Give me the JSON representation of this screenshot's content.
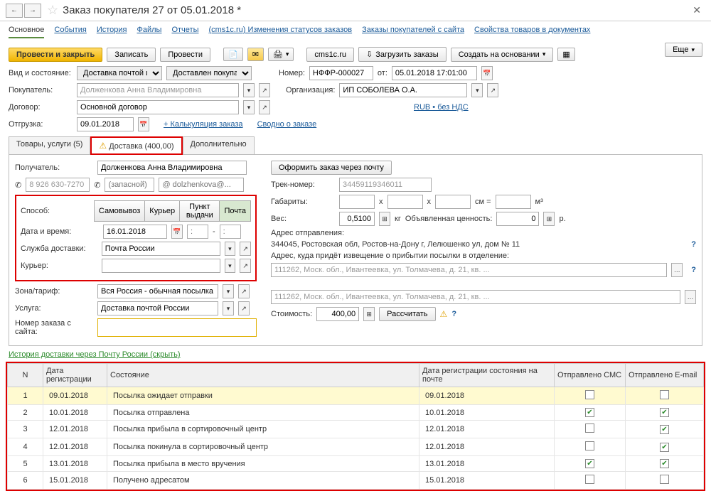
{
  "header": {
    "title": "Заказ покупателя 27 от 05.01.2018 *"
  },
  "nav_links": {
    "main": "Основное",
    "events": "События",
    "history": "История",
    "files": "Файлы",
    "reports": "Отчеты",
    "cms_status": "(cms1c.ru) Изменения статусов заказов",
    "site_orders": "Заказы покупателей с сайта",
    "doc_props": "Свойства товаров в документах"
  },
  "toolbar": {
    "post_close": "Провести и закрыть",
    "save": "Записать",
    "post": "Провести",
    "cms": "cms1c.ru",
    "load": "Загрузить заказы",
    "create_based": "Создать на основании",
    "more": "Еще"
  },
  "form": {
    "kind_label": "Вид и состояние:",
    "kind_v1": "Доставка почтой и другое",
    "kind_v2": "Доставлен покупателю",
    "num_label": "Номер:",
    "num_val": "НФФР-000027",
    "from_label": "от:",
    "date_val": "05.01.2018 17:01:00",
    "buyer_label": "Покупатель:",
    "buyer_val": "Долженкова Анна Владимировна",
    "org_label": "Организация:",
    "org_val": "ИП СОБОЛЕВА О.А.",
    "contract_label": "Договор:",
    "contract_val": "Основной договор",
    "currency": "RUB • без НДС",
    "ship_label": "Отгрузка:",
    "ship_val": "09.01.2018",
    "calc_link": "+ Калькуляция заказа",
    "summary_link": "Сводно о заказе"
  },
  "tabs": {
    "t1": "Товары, услуги (5)",
    "t2": "Доставка (400,00)",
    "t3": "Дополнительно"
  },
  "delivery": {
    "recipient_label": "Получатель:",
    "recipient_val": "Долженкова Анна Владимировна",
    "phone1": "8 926 630-7270",
    "phone2_ph": "(запасной)",
    "email_ph": "@ dolzhenkova@...",
    "order_mail_btn": "Оформить заказ через почту",
    "track_label": "Трек-номер:",
    "track_val": "34459119346011",
    "dims_label": "Габариты:",
    "cm": "см =",
    "m3": "м³",
    "weight_label": "Вес:",
    "weight_val": "0,5100",
    "kg": "кг",
    "declared_label": "Объявленная ценность:",
    "declared_val": "0",
    "rub": "р.",
    "method_label": "Способ:",
    "seg_pickup": "Самовывоз",
    "seg_courier": "Курьер",
    "seg_point": "Пункт выдачи",
    "seg_post": "Почта",
    "datetime_label": "Дата и время:",
    "datetime_val": "16.01.2018",
    "service_label": "Служба доставки:",
    "service_val": "Почта России",
    "courier_label": "Курьер:",
    "send_addr_label": "Адрес отправления:",
    "send_addr_val": "344045, Ростовская обл, Ростов-на-Дону г, Лелюшенко ул, дом № 11",
    "notify_addr_label": "Адрес, куда придёт извещение о прибытии посылки в отделение:",
    "addr1_val": "111262, Моск. обл., Ивантеевка, ул. Толмачева, д. 21, кв. ...",
    "addr2_val": "111262, Моск. обл., Ивантеевка, ул. Толмачева, д. 21, кв. ...",
    "zone_label": "Зона/тариф:",
    "zone_val": "Вся Россия - обычная посылка",
    "dservice_label": "Услуга:",
    "dservice_val": "Доставка почтой России",
    "cost_label": "Стоимость:",
    "cost_val": "400,00",
    "calc_btn": "Рассчитать",
    "site_order_label": "Номер заказа с сайта:"
  },
  "history": {
    "toggle": "История доставки через Почту России (скрыть)",
    "cols": {
      "n": "N",
      "reg": "Дата регистрации",
      "state": "Состояние",
      "post_reg": "Дата регистрации состояния на почте",
      "sms": "Отправлено СМС",
      "email": "Отправлено E-mail"
    },
    "rows": [
      {
        "n": "1",
        "reg": "09.01.2018",
        "state": "Посылка ожидает отправки",
        "post_reg": "09.01.2018",
        "sms": false,
        "email": false,
        "hl": true
      },
      {
        "n": "2",
        "reg": "10.01.2018",
        "state": "Посылка отправлена",
        "post_reg": "10.01.2018",
        "sms": true,
        "email": true,
        "hl": false
      },
      {
        "n": "3",
        "reg": "12.01.2018",
        "state": "Посылка прибыла в сортировочный центр",
        "post_reg": "12.01.2018",
        "sms": false,
        "email": true,
        "hl": false
      },
      {
        "n": "4",
        "reg": "12.01.2018",
        "state": "Посылка покинула в сортировочный центр",
        "post_reg": "12.01.2018",
        "sms": false,
        "email": true,
        "hl": false
      },
      {
        "n": "5",
        "reg": "13.01.2018",
        "state": "Посылка прибыла в место вручения",
        "post_reg": "13.01.2018",
        "sms": true,
        "email": true,
        "hl": false
      },
      {
        "n": "6",
        "reg": "15.01.2018",
        "state": "Получено адресатом",
        "post_reg": "15.01.2018",
        "sms": false,
        "email": false,
        "hl": false
      }
    ]
  }
}
